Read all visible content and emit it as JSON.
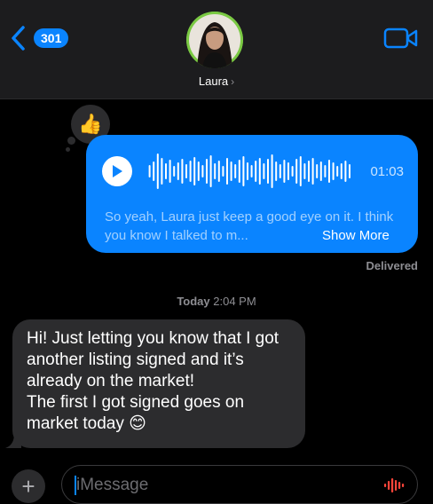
{
  "header": {
    "back_count": "301",
    "contact_name": "Laura",
    "contact_chevron": "›",
    "icons": {
      "back": "chevron-left-icon",
      "video": "video-camera-icon"
    }
  },
  "tapback": {
    "emoji": "👍"
  },
  "audio_message": {
    "duration": "01:03",
    "transcript": "So yeah, Laura just keep a good eye on it. I think you know I talked to m...",
    "show_more_label": "Show More",
    "status": "Delivered"
  },
  "timestamp": {
    "day": "Today",
    "time": "2:04 PM"
  },
  "incoming_message": {
    "lines": [
      "Hi! Just letting you know that I got",
      "another listing signed and it’s",
      "already on the market!",
      "The first I got signed goes on",
      "market today 😊"
    ]
  },
  "composer": {
    "placeholder": "iMessage",
    "value": ""
  },
  "colors": {
    "accent": "#0a84ff",
    "bubble_in": "#2c2c2e",
    "header_bg": "#1c1c1e"
  }
}
